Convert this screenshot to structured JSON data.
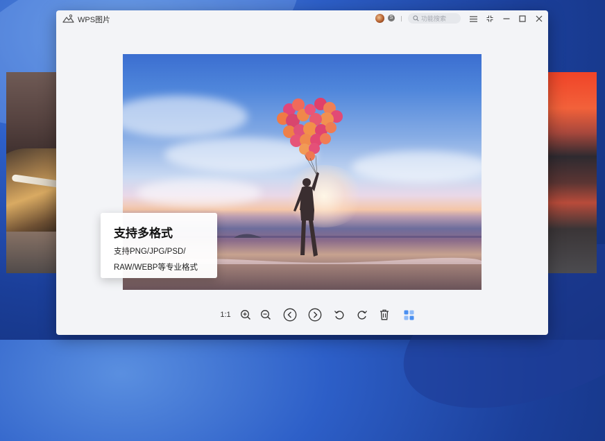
{
  "app": {
    "title": "WPS图片"
  },
  "header": {
    "search_placeholder": "功能搜索",
    "badge": "S"
  },
  "toolbar": {
    "ratio_label": "1:1"
  },
  "info_card": {
    "title": "支持多格式",
    "line1": "支持PNG/JPG/PSD/",
    "line2": "RAW/WEBP等专业格式"
  },
  "colors": {
    "accent": "#4a8ff0",
    "window_bg": "#f3f4f7"
  },
  "icons": [
    "app-logo-icon",
    "search-icon",
    "menu-icon",
    "fullscreen-icon",
    "minimize-icon",
    "maximize-icon",
    "close-icon",
    "zoom-in-icon",
    "zoom-out-icon",
    "previous-icon",
    "next-icon",
    "rotate-left-icon",
    "rotate-right-icon",
    "delete-icon",
    "gallery-icon"
  ]
}
